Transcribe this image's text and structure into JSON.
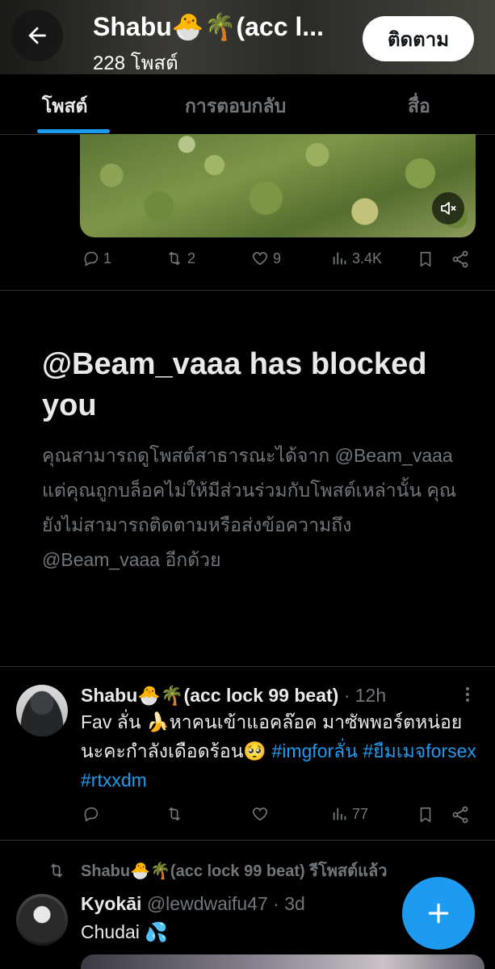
{
  "header": {
    "title": "Shabu🐣🌴(acc l...",
    "post_count": "228 โพสต์",
    "follow_label": "ติดตาม"
  },
  "tabs": [
    {
      "label": "โพสต์",
      "active": true
    },
    {
      "label": "การตอบกลับ",
      "active": false
    },
    {
      "label": "สื่อ",
      "active": false
    }
  ],
  "video_post": {
    "replies": "1",
    "reposts": "2",
    "likes": "9",
    "views": "3.4K"
  },
  "blocked": {
    "title": "@Beam_vaaa has blocked you",
    "body": "คุณสามารถดูโพสต์สาธารณะได้จาก @Beam_vaaa แต่คุณถูกบล็อคไม่ให้มีส่วนร่วมกับโพสต์เหล่านั้น คุณยังไม่สามารถติดตามหรือส่งข้อความถึง @Beam_vaaa อีกด้วย"
  },
  "tweet1": {
    "name": "Shabu🐣🌴(acc lock 99 beat)",
    "time": "· 12h",
    "text": "Fav ลั่น 🍌หาคนเข้าแอคล๊อค มาซัพพอร์ตหน่อยนะคะกำลังเดือดร้อน🥺 ",
    "hashtags": [
      "#imgforลั่น",
      "#ยืมเมจforsex",
      "#rtxxdm"
    ],
    "views": "77"
  },
  "retweet_notice": {
    "text": "Shabu🐣🌴(acc lock 99 beat) รีโพสต์แล้ว"
  },
  "tweet2": {
    "name": "Kyokāi",
    "handle": "@lewdwaifu47",
    "time": "· 3d",
    "text": "Chudai 💦"
  },
  "colors": {
    "accent": "#1d9bf0",
    "text_primary": "#e7e9ea",
    "text_secondary": "#71767b",
    "background": "#000000",
    "divider": "#2f3336"
  },
  "icons": [
    "back-arrow-icon",
    "mute-icon",
    "reply-icon",
    "repost-icon",
    "like-icon",
    "views-icon",
    "bookmark-icon",
    "share-icon",
    "more-icon",
    "plus-icon"
  ]
}
